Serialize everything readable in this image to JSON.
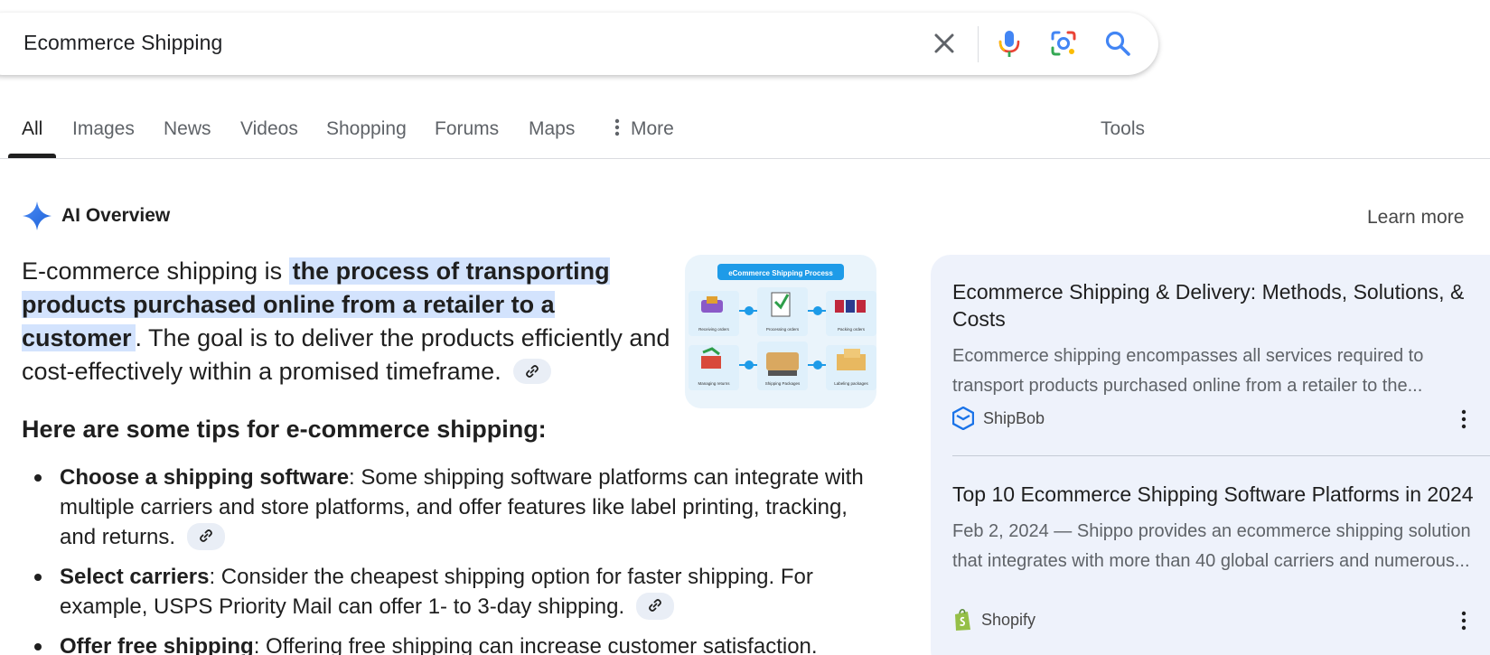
{
  "search": {
    "query": "Ecommerce Shipping",
    "icons": [
      "close-icon",
      "microphone-icon",
      "lens-icon",
      "search-icon"
    ]
  },
  "tabs": [
    {
      "label": "All",
      "active": true
    },
    {
      "label": "Images"
    },
    {
      "label": "News"
    },
    {
      "label": "Videos"
    },
    {
      "label": "Shopping"
    },
    {
      "label": "Forums"
    },
    {
      "label": "Maps"
    },
    {
      "label": "More",
      "icon": "more-vert-icon"
    }
  ],
  "tools_label": "Tools",
  "ai_overview": {
    "title": "AI Overview",
    "learn_more": "Learn more",
    "answer_prefix": "E-commerce shipping is ",
    "answer_highlight": "the process of transporting products purchased online from a retailer to a customer",
    "answer_suffix": ". The goal is to deliver the products efficiently and cost-effectively within a promised timeframe.",
    "thumbnail": {
      "banner": "eCommerce Shipping Process",
      "steps": [
        "Receiving orders",
        "Processing orders",
        "Packing orders",
        "Managing returns",
        "Shipping Packages",
        "Labeling packages"
      ]
    },
    "tips_heading": "Here are some tips for e-commerce shipping:",
    "tips": [
      {
        "bold": "Choose a shipping software",
        "text": ": Some shipping software platforms can integrate with multiple carriers and store platforms, and offer features like label printing, tracking, and returns."
      },
      {
        "bold": "Select carriers",
        "text": ": Consider the cheapest shipping option for faster shipping. For example, USPS Priority Mail can offer 1- to 3-day shipping."
      },
      {
        "bold": "Offer free shipping",
        "text": ": Offering free shipping can increase customer satisfaction."
      }
    ]
  },
  "sources": [
    {
      "title": "Ecommerce Shipping & Delivery: Methods, Solutions, & Costs",
      "snippet_line1": "Ecommerce shipping encompasses all services required to",
      "snippet_line2": "transport products purchased online from a retailer to the...",
      "site": "ShipBob",
      "site_icon": "shipbob-logo-icon"
    },
    {
      "title": "Top 10 Ecommerce Shipping Software Platforms in 2024",
      "snippet_line1": "Feb 2, 2024 — Shippo provides an ecommerce shipping solution",
      "snippet_line2": "that integrates with more than 40 global carriers and numerous...",
      "site": "Shopify",
      "site_icon": "shopify-logo-icon"
    }
  ],
  "colors": {
    "accent_blue": "#1a73e8",
    "highlight": "#d3e3fd",
    "panel": "#eef2fb"
  }
}
